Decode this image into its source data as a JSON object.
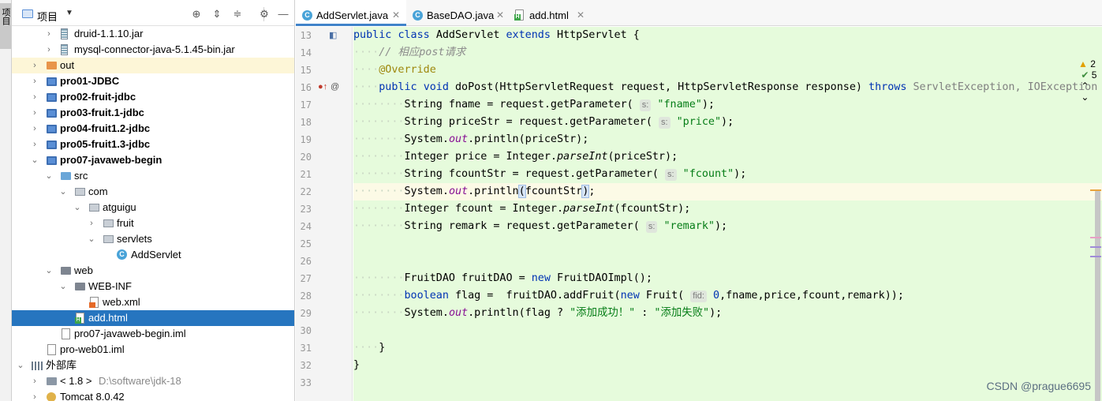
{
  "toolstrip": {
    "label": "项目"
  },
  "project": {
    "title": "项目",
    "tree": [
      {
        "label": "druid-1.1.10.jar",
        "icon": "jar-icon",
        "bold": false
      },
      {
        "label": "mysql-connector-java-5.1.45-bin.jar",
        "icon": "jar-icon",
        "bold": false
      },
      {
        "label": "out",
        "icon": "folder-icon",
        "bold": false
      },
      {
        "label": "pro01-JDBC",
        "icon": "module-icon",
        "bold": true
      },
      {
        "label": "pro02-fruit-jdbc",
        "icon": "module-icon",
        "bold": true
      },
      {
        "label": "pro03-fruit.1-jdbc",
        "icon": "module-icon",
        "bold": true
      },
      {
        "label": "pro04-fruit1.2-jdbc",
        "icon": "module-icon",
        "bold": true
      },
      {
        "label": "pro05-fruit1.3-jdbc",
        "icon": "module-icon",
        "bold": true
      },
      {
        "label": "pro07-javaweb-begin",
        "icon": "module-icon",
        "bold": true
      },
      {
        "label": "src",
        "icon": "source-folder-icon",
        "bold": false
      },
      {
        "label": "com",
        "icon": "package-icon",
        "bold": false
      },
      {
        "label": "atguigu",
        "icon": "package-icon",
        "bold": false
      },
      {
        "label": "fruit",
        "icon": "package-icon",
        "bold": false
      },
      {
        "label": "servlets",
        "icon": "package-icon",
        "bold": false
      },
      {
        "label": "AddServlet",
        "icon": "class-icon",
        "bold": false
      },
      {
        "label": "web",
        "icon": "folder-icon",
        "bold": false
      },
      {
        "label": "WEB-INF",
        "icon": "folder-icon",
        "bold": false
      },
      {
        "label": "web.xml",
        "icon": "xml-file-icon",
        "bold": false
      },
      {
        "label": "add.html",
        "icon": "html-file-icon",
        "bold": false
      },
      {
        "label": "pro07-javaweb-begin.iml",
        "icon": "iml-file-icon",
        "bold": false
      },
      {
        "label": "pro-web01.iml",
        "icon": "iml-file-icon",
        "bold": false
      },
      {
        "label": "外部库",
        "icon": "library-icon",
        "bold": false
      },
      {
        "label": "< 1.8 >",
        "extra": "D:\\software\\jdk-18",
        "icon": "sdk-icon",
        "bold": false
      },
      {
        "label": "Tomcat 8.0.42",
        "icon": "tomcat-icon",
        "bold": false
      }
    ]
  },
  "tabs": [
    {
      "label": "AddServlet.java",
      "active": true
    },
    {
      "label": "BaseDAO.java",
      "active": false
    },
    {
      "label": "add.html",
      "active": false
    }
  ],
  "editor": {
    "line_numbers": [
      "13",
      "14",
      "15",
      "16",
      "17",
      "18",
      "19",
      "20",
      "21",
      "22",
      "23",
      "24",
      "25",
      "26",
      "27",
      "28",
      "29",
      "30",
      "31",
      "32",
      "33"
    ],
    "inspections": {
      "warnings": "2",
      "ok": "5"
    },
    "code": {
      "l13": [
        "public",
        "class",
        "AddServlet",
        "extends",
        "HttpServlet",
        "{"
      ],
      "l14_comment": "// 相应post请求",
      "l15": "@Override",
      "l16": [
        "public",
        "void",
        "doPost(HttpServletRequest request, HttpServletResponse response)",
        "throws",
        "ServletException, IOException"
      ],
      "l17": [
        "String fname = request.getParameter(",
        "s:",
        "\"fname\"",
        ");"
      ],
      "l18": [
        "String priceStr = request.getParameter(",
        "s:",
        "\"price\"",
        ");"
      ],
      "l19": [
        "System.",
        "out",
        ".println(priceStr);"
      ],
      "l20": [
        "Integer price = Integer.",
        "parseInt",
        "(priceStr);"
      ],
      "l21": [
        "String fcountStr = request.getParameter(",
        "s:",
        "\"fcount\"",
        ");"
      ],
      "l22": [
        "System.",
        "out",
        ".println",
        "(",
        "fcountStr",
        ")",
        ";"
      ],
      "l23": [
        "Integer fcount = Integer.",
        "parseInt",
        "(fcountStr);"
      ],
      "l24": [
        "String remark = request.getParameter(",
        "s:",
        "\"remark\"",
        ");"
      ],
      "l27": [
        "FruitDAO fruitDAO = ",
        "new",
        "FruitDAOImpl();"
      ],
      "l28": [
        "boolean",
        "flag =  fruitDAO.addFruit(",
        "new",
        "Fruit(",
        "fid:",
        "0",
        ",fname,price,fcount,remark));"
      ],
      "l29": [
        "System.",
        "out",
        ".println(flag ? ",
        "\"添加成功！\"",
        " : ",
        "\"添加失败\"",
        ");"
      ],
      "l31": "}",
      "l32": "}"
    }
  },
  "watermark": "CSDN @prague6695",
  "colors": {
    "editor_bg": "#e6fbdc",
    "selection": "#2675bf",
    "keyword": "#0033b3",
    "string": "#067d17"
  }
}
